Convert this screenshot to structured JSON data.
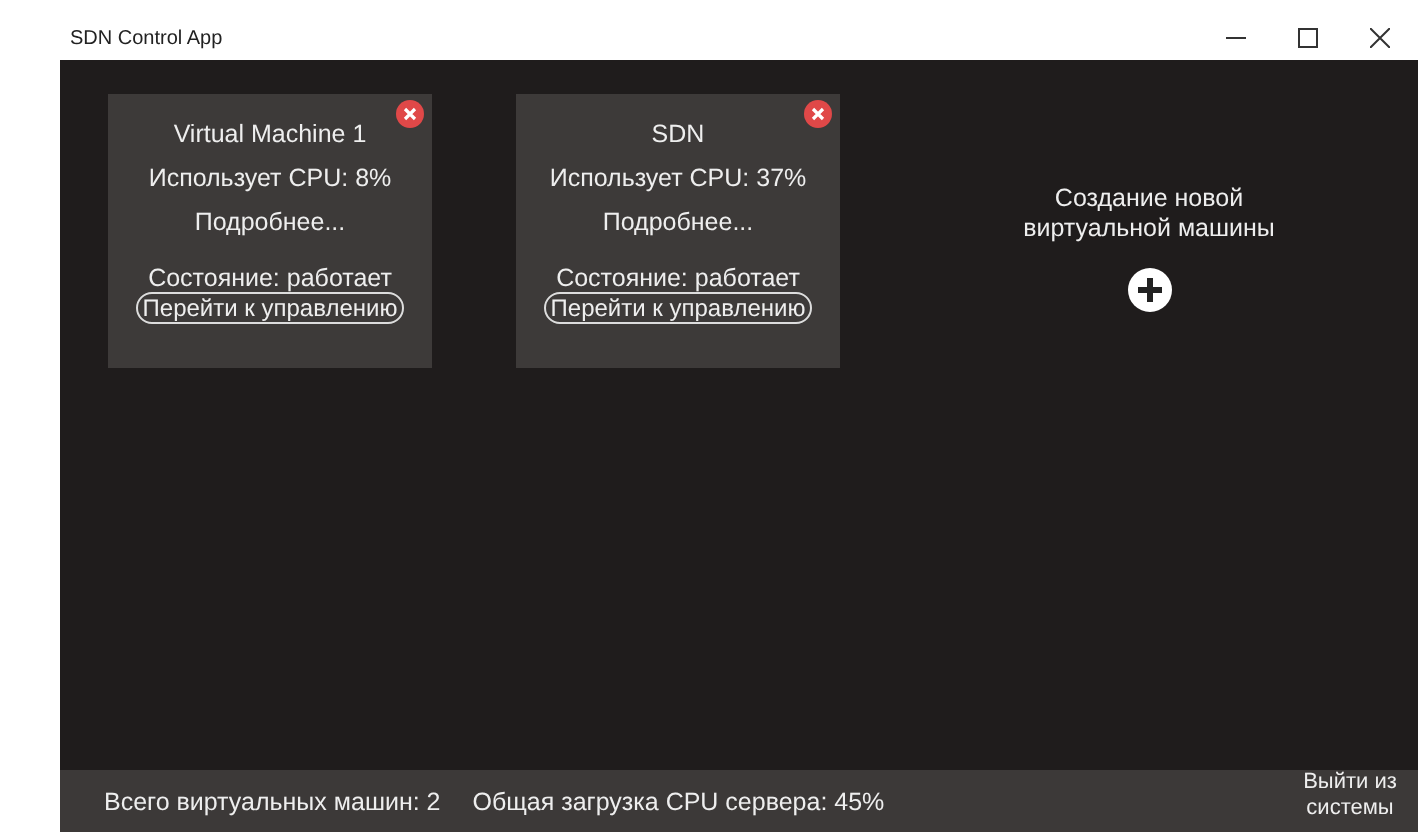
{
  "window": {
    "title": "SDN Control App"
  },
  "machines": [
    {
      "name": "Virtual Machine 1",
      "cpu": "Использует CPU: 8%",
      "details": "Подробнее...",
      "state": "Состояние: работает",
      "manage": "Перейти к управлению"
    },
    {
      "name": "SDN",
      "cpu": "Использует CPU: 37%",
      "details": "Подробнее...",
      "state": "Состояние: работает",
      "manage": "Перейти к управлению"
    }
  ],
  "create": {
    "label": "Создание новой виртуальной машины"
  },
  "status_bar": {
    "total": "Всего виртуальных машин: 2",
    "cpu": "Общая загрузка CPU сервера: 45%",
    "logout": "Выйти из системы"
  }
}
